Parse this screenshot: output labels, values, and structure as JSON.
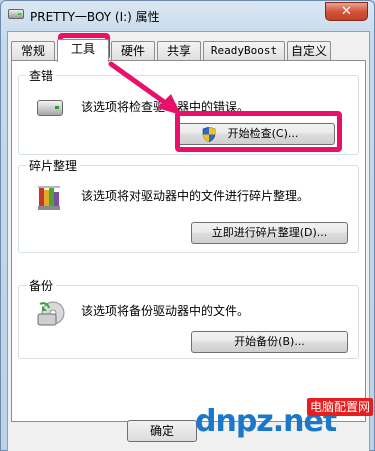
{
  "window": {
    "title": "PRETTY一BOY (I:) 属性",
    "close_symbol": "✕"
  },
  "tabs": [
    {
      "label": "常规",
      "active": false
    },
    {
      "label": "工具",
      "active": true
    },
    {
      "label": "硬件",
      "active": false
    },
    {
      "label": "共享",
      "active": false
    },
    {
      "label": "ReadyBoost",
      "active": false
    },
    {
      "label": "自定义",
      "active": false
    }
  ],
  "check": {
    "title": "查错",
    "description": "该选项将检查驱动器中的错误。",
    "button": "开始检查(C)...",
    "icon": "drive-icon"
  },
  "defrag": {
    "title": "碎片整理",
    "description": "该选项将对驱动器中的文件进行碎片整理。",
    "button": "立即进行碎片整理(D)...",
    "icon": "defrag-icon"
  },
  "backup": {
    "title": "备份",
    "description": "该选项将备份驱动器中的文件。",
    "button": "开始备份(B)...",
    "icon": "backup-icon"
  },
  "footer": {
    "ok_button": "确定"
  },
  "watermark": {
    "text": "dnpz.net",
    "badge": "电脑配置网"
  },
  "annotations": {
    "highlight_color": "#e8106a"
  }
}
